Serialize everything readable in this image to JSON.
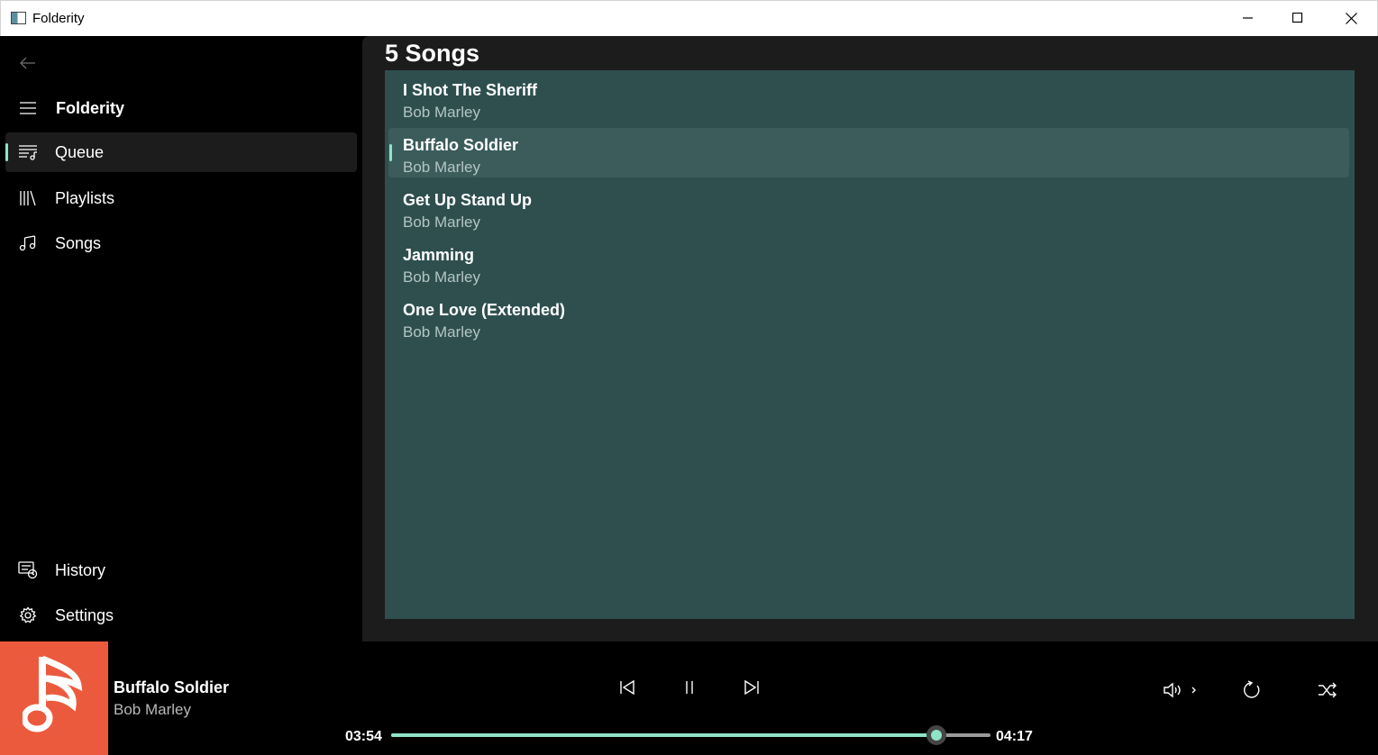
{
  "window": {
    "title": "Folderity"
  },
  "sidebar": {
    "header_label": "Folderity",
    "items": [
      {
        "label": "Queue",
        "icon": "queue-icon",
        "selected": true
      },
      {
        "label": "Playlists",
        "icon": "playlists-icon",
        "selected": false
      },
      {
        "label": "Songs",
        "icon": "music-note-icon",
        "selected": false
      }
    ],
    "footer_items": [
      {
        "label": "History",
        "icon": "history-icon"
      },
      {
        "label": "Settings",
        "icon": "gear-icon"
      }
    ]
  },
  "main": {
    "title": "5 Songs",
    "songs": [
      {
        "title": "I Shot The Sheriff",
        "artist": "Bob Marley"
      },
      {
        "title": "Buffalo Soldier",
        "artist": "Bob Marley",
        "selected": true
      },
      {
        "title": "Get Up Stand Up",
        "artist": "Bob Marley"
      },
      {
        "title": "Jamming",
        "artist": "Bob Marley"
      },
      {
        "title": "One Love (Extended)",
        "artist": "Bob Marley"
      }
    ]
  },
  "player": {
    "title": "Buffalo Soldier",
    "artist": "Bob Marley",
    "elapsed": "03:54",
    "duration": "04:17",
    "progress_fraction": 0.9105
  },
  "colors": {
    "accent": "#8fe3c8",
    "list_background": "#2f4f4f",
    "album_art": "#ec5a3e"
  }
}
